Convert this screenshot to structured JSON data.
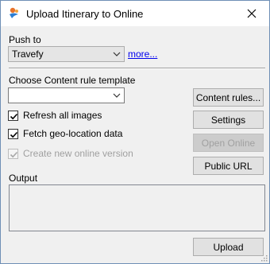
{
  "window": {
    "title": "Upload Itinerary to Online"
  },
  "push_to": {
    "label": "Push to",
    "selected": "Travefy",
    "more_link": "more..."
  },
  "content_rule": {
    "label": "Choose Content rule template",
    "selected": ""
  },
  "options": {
    "refresh_images": {
      "label": "Refresh all images",
      "checked": true
    },
    "fetch_geo": {
      "label": "Fetch geo-location data",
      "checked": true
    },
    "create_version": {
      "label": "Create new online version",
      "checked": true,
      "disabled": true
    }
  },
  "buttons": {
    "content_rules": "Content rules...",
    "settings": "Settings",
    "open_online": "Open Online",
    "public_url": "Public URL",
    "upload": "Upload"
  },
  "output": {
    "label": "Output",
    "text": ""
  },
  "colors": {
    "accent_orange": "#e8732a",
    "accent_blue": "#2d7fd3",
    "link": "#0000ee"
  },
  "icons": {
    "app": "app-logo-icon",
    "close": "close-icon",
    "dropdown": "chevron-down-icon",
    "check": "checkmark-icon",
    "grip": "resize-grip-icon"
  }
}
